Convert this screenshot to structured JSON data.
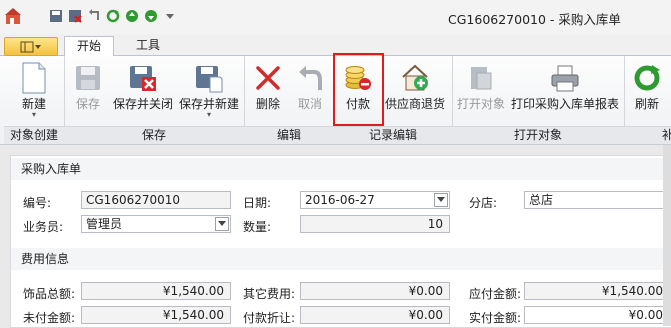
{
  "window": {
    "title": "CG1606270010 - 采购入库单"
  },
  "tabs": [
    {
      "label": "开始"
    },
    {
      "label": "工具"
    }
  ],
  "ribbon": {
    "groups": [
      {
        "label": "对象创建",
        "buttons": [
          {
            "label": "新建",
            "icon": "new-document-icon"
          }
        ]
      },
      {
        "label": "保存",
        "buttons": [
          {
            "label": "保存",
            "icon": "floppy-disk-icon",
            "disabled": true
          },
          {
            "label": "保存并关闭",
            "icon": "save-close-icon"
          },
          {
            "label": "保存并新建",
            "icon": "save-new-icon"
          }
        ]
      },
      {
        "label": "编辑",
        "buttons": [
          {
            "label": "删除",
            "icon": "delete-x-icon"
          },
          {
            "label": "取消",
            "icon": "undo-arrow-icon",
            "disabled": true
          }
        ]
      },
      {
        "label": "记录编辑",
        "buttons": [
          {
            "label": "付款",
            "icon": "coins-payment-icon"
          },
          {
            "label": "供应商退货",
            "icon": "house-return-icon"
          }
        ]
      },
      {
        "label": "打开对象",
        "buttons": [
          {
            "label": "打开对象",
            "icon": "open-object-icon",
            "disabled": true
          },
          {
            "label": "打印采购入库单报表",
            "icon": "printer-icon"
          }
        ]
      },
      {
        "label": "补",
        "buttons": [
          {
            "label": "刷新",
            "icon": "refresh-icon"
          }
        ]
      }
    ]
  },
  "form": {
    "section1_title": "采购入库单",
    "code_label": "编号:",
    "code_value": "CG1606270010",
    "date_label": "日期:",
    "date_value": "2016-06-27",
    "branch_label": "分店:",
    "branch_value": "总店",
    "clerk_label": "业务员:",
    "clerk_value": "管理员",
    "qty_label": "数量:",
    "qty_value": "10",
    "section2_title": "费用信息",
    "goods_total_label": "饰品总额:",
    "goods_total_value": "¥1,540.00",
    "other_fee_label": "其它费用:",
    "other_fee_value": "¥0.00",
    "payable_label": "应付金额:",
    "payable_value": "¥1,540.00",
    "unpaid_label": "未付金额:",
    "unpaid_value": "¥1,540.00",
    "discount_label": "付款折让:",
    "discount_value": "¥0.00",
    "paid_label": "实付金额:",
    "paid_value": "¥0.00"
  },
  "colors": {
    "highlight": "#e21b1b",
    "accent": "#f3c23f"
  }
}
